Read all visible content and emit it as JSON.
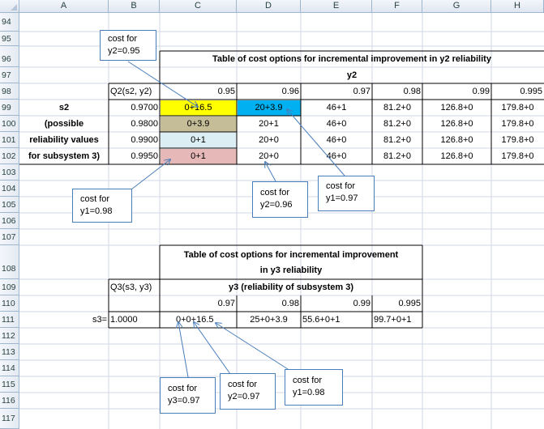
{
  "columns": [
    "A",
    "B",
    "C",
    "D",
    "E",
    "F",
    "G",
    "H"
  ],
  "rows": [
    "94",
    "95",
    "96",
    "97",
    "98",
    "99",
    "100",
    "101",
    "102",
    "103",
    "104",
    "105",
    "106",
    "107",
    "108",
    "109",
    "110",
    "111",
    "112",
    "113",
    "114",
    "115",
    "116",
    "117"
  ],
  "table1": {
    "title": "Table of cost options for incremental improvement in y2 reliability",
    "y_header": "y2",
    "q_label": "Q2(s2, y2)",
    "y_values": [
      "0.95",
      "0.96",
      "0.97",
      "0.98",
      "0.99",
      "0.995"
    ],
    "s_label": [
      "s2",
      "(possible",
      "reliability values",
      "for subsystem 3)"
    ],
    "s_values": [
      "0.9700",
      "0.9800",
      "0.9900",
      "0.9950"
    ],
    "cells": [
      [
        "0+16.5",
        "20+3.9",
        "46+1",
        "81.2+0",
        "126.8+0",
        "179.8+0"
      ],
      [
        "0+3.9",
        "20+1",
        "46+0",
        "81.2+0",
        "126.8+0",
        "179.8+0"
      ],
      [
        "0+1",
        "20+0",
        "46+0",
        "81.2+0",
        "126.8+0",
        "179.8+0"
      ],
      [
        "0+1",
        "20+0",
        "46+0",
        "81.2+0",
        "126.8+0",
        "179.8+0"
      ]
    ]
  },
  "table2": {
    "title_line1": "Table of cost options for incremental improvement",
    "title_line2": "in y3 reliability",
    "y_header": "y3 (reliability of subsystem 3)",
    "q_label": "Q3(s3, y3)",
    "y_values": [
      "0.97",
      "0.98",
      "0.99",
      "0.995"
    ],
    "s_label": "s3=",
    "s_value": "1.0000",
    "cells": [
      "0+0+16.5",
      "25+0+3.9",
      "55.6+0+1",
      "99.7+0+1"
    ]
  },
  "callouts": {
    "c1_line1": "cost for",
    "c1_line2": "y2=0.95",
    "c2_line1": "cost for",
    "c2_line2": "y1=0.98",
    "c3_line1": "cost for",
    "c3_line2": "y2=0.96",
    "c4_line1": "cost for",
    "c4_line2": "y1=0.97",
    "c5_line1": "cost for",
    "c5_line2": "y3=0.97",
    "c6_line1": "cost for",
    "c6_line2": "y2=0.97",
    "c7_line1": "cost for",
    "c7_line2": "y1=0.98"
  },
  "colors": {
    "highlight_yellow": "#ffff00",
    "highlight_blue": "#00b0f0",
    "highlight_tan": "#c4bd97",
    "highlight_lightblue": "#dbeef4",
    "highlight_pink": "#e6b8b7",
    "arrow": "#4a7ebb"
  }
}
